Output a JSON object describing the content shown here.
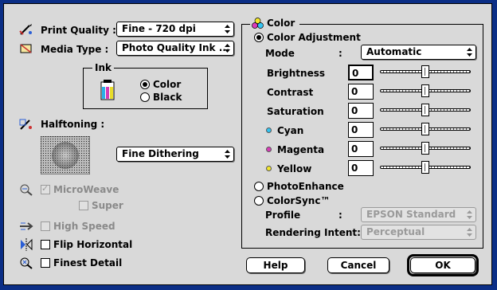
{
  "print_quality": {
    "label": "Print Quality :",
    "value": "Fine - 720 dpi"
  },
  "media_type": {
    "label": "Media Type :",
    "value": "Photo Quality Ink ..."
  },
  "ink": {
    "title": "Ink",
    "options": [
      "Color",
      "Black"
    ],
    "selected": "Color"
  },
  "halftoning": {
    "label": "Halftoning :",
    "value": "Fine Dithering"
  },
  "checkboxes": {
    "microweave": {
      "label": "MicroWeave",
      "checked": true,
      "enabled": false
    },
    "super": {
      "label": "Super",
      "checked": false,
      "enabled": false
    },
    "high_speed": {
      "label": "High Speed",
      "checked": false,
      "enabled": false
    },
    "flip_horizontal": {
      "label": "Flip Horizontal",
      "checked": false,
      "enabled": true
    },
    "finest_detail": {
      "label": "Finest Detail",
      "checked": false,
      "enabled": true
    }
  },
  "color": {
    "title": "Color",
    "color_adjustment": {
      "label": "Color Adjustment",
      "selected": true
    },
    "mode": {
      "label": "Mode",
      "colon": ":",
      "value": "Automatic"
    },
    "sliders": [
      {
        "label": "Brightness",
        "value": "0",
        "position": 0.5,
        "dot": null,
        "focused": true
      },
      {
        "label": "Contrast",
        "value": "0",
        "position": 0.5,
        "dot": null,
        "focused": false
      },
      {
        "label": "Saturation",
        "value": "0",
        "position": 0.5,
        "dot": null,
        "focused": false
      },
      {
        "label": "Cyan",
        "value": "0",
        "position": 0.5,
        "dot": "#33c4f2",
        "focused": false
      },
      {
        "label": "Magenta",
        "value": "0",
        "position": 0.5,
        "dot": "#d93cb9",
        "focused": false
      },
      {
        "label": "Yellow",
        "value": "0",
        "position": 0.5,
        "dot": "#f2e62b",
        "focused": false
      }
    ],
    "photo_enhance": {
      "label": "PhotoEnhance"
    },
    "colorsync": {
      "label": "ColorSync™"
    },
    "profile": {
      "label": "Profile",
      "colon": ":",
      "value": "EPSON Standard"
    },
    "rendering_intent": {
      "label": "Rendering Intent:",
      "value": "Perceptual"
    }
  },
  "buttons": {
    "help": "Help",
    "cancel": "Cancel",
    "ok": "OK"
  },
  "colors": {
    "window_bg": "#d9d9d9",
    "desktop_bg": "#0b2e86"
  }
}
